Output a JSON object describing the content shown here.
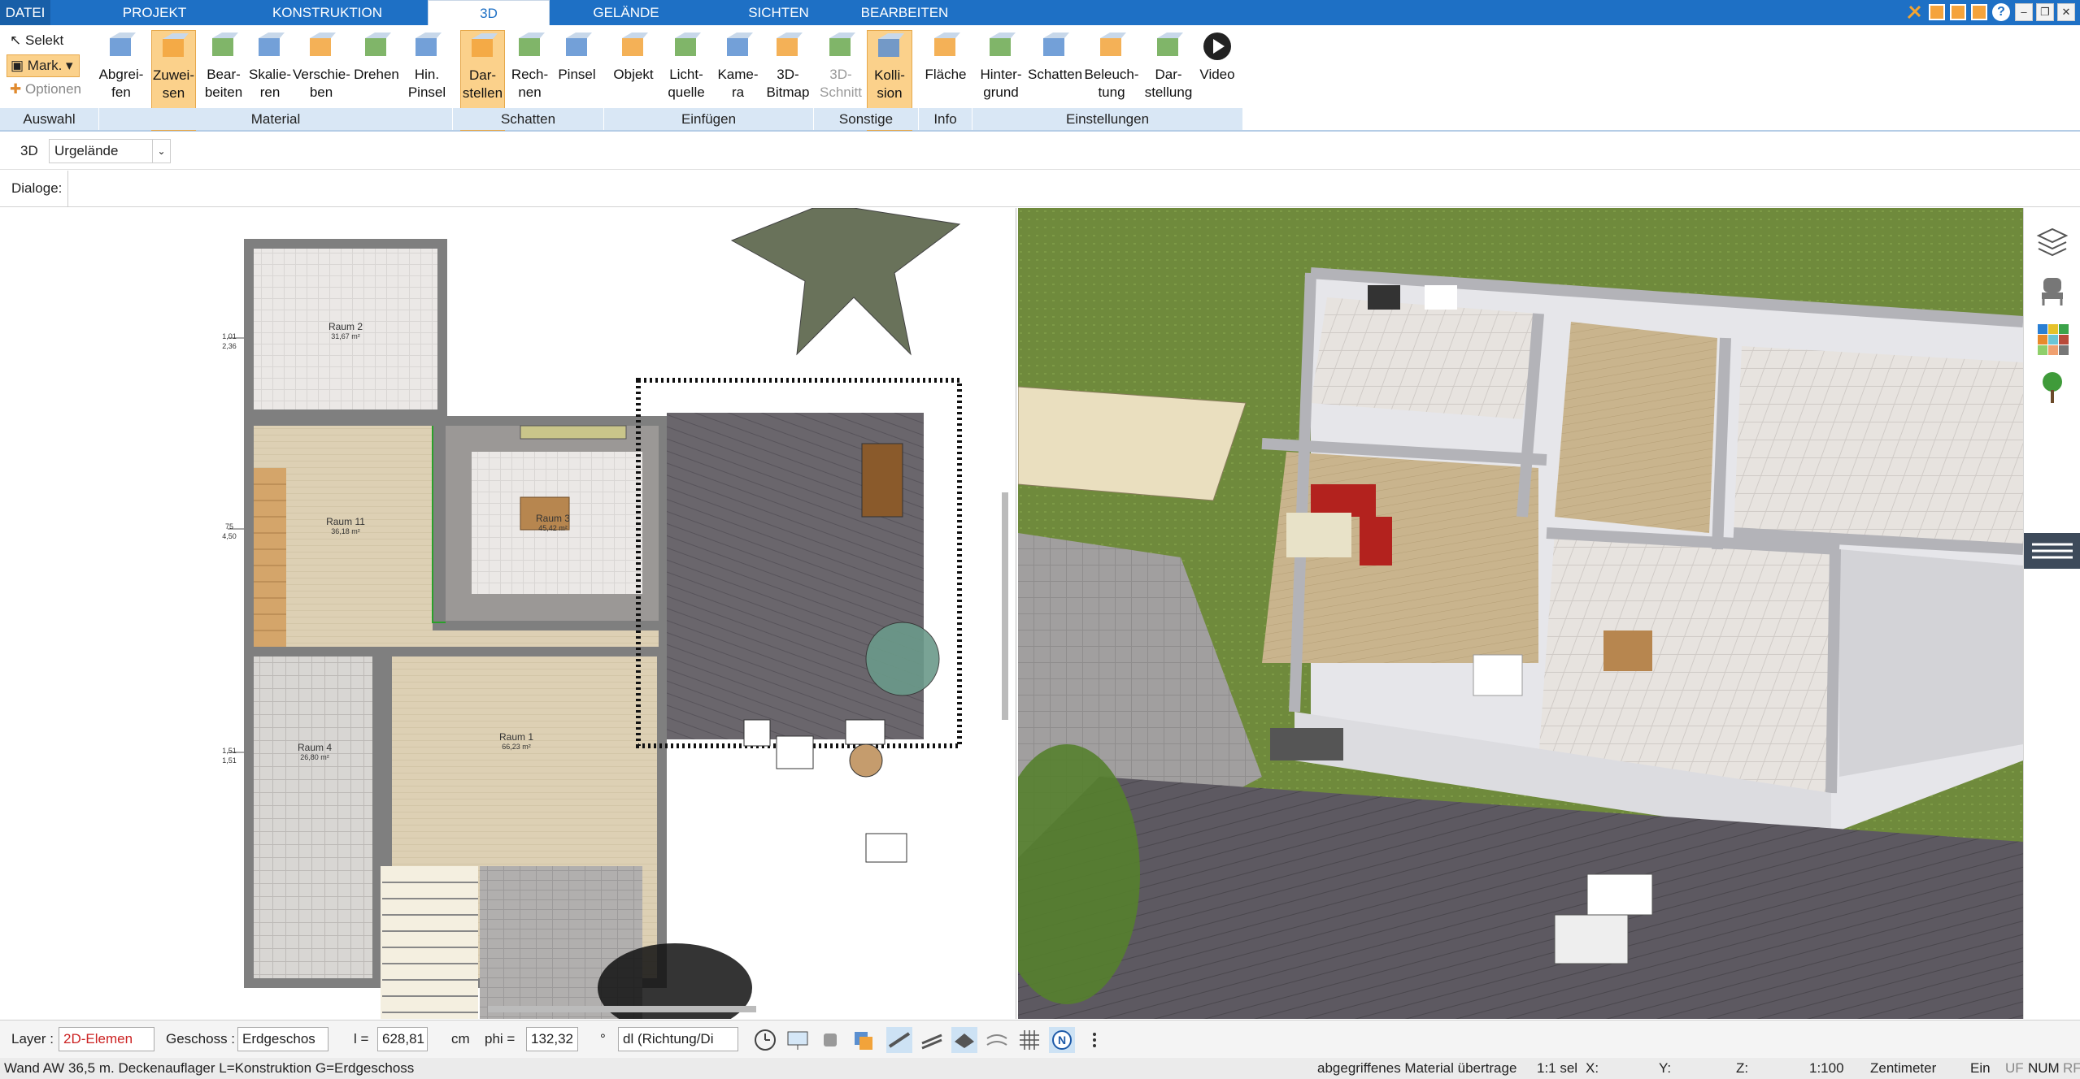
{
  "menu": {
    "tabs": [
      "DATEI",
      "PROJEKT",
      "KONSTRUKTION",
      "3D",
      "GELÄNDE",
      "SICHTEN",
      "BEARBEITEN"
    ],
    "active": "3D"
  },
  "window_controls": [
    "minimize",
    "restore",
    "close"
  ],
  "ribbon": {
    "auswahl": {
      "select": "Selekt",
      "mark": "Mark.",
      "options": "Optionen",
      "group": "Auswahl"
    },
    "material": {
      "group": "Material",
      "buttons": [
        {
          "l1": "Abgrei-",
          "l2": "fen"
        },
        {
          "l1": "Zuwei-",
          "l2": "sen"
        },
        {
          "l1": "Bear-",
          "l2": "beiten"
        },
        {
          "l1": "Skalie-",
          "l2": "ren"
        },
        {
          "l1": "Verschie-",
          "l2": "ben"
        },
        {
          "l1": "Drehen",
          "l2": ""
        },
        {
          "l1": "Hin.",
          "l2": "Pinsel"
        }
      ]
    },
    "schatten": {
      "group": "Schatten",
      "buttons": [
        {
          "l1": "Dar-",
          "l2": "stellen"
        },
        {
          "l1": "Rech-",
          "l2": "nen"
        },
        {
          "l1": "Pinsel",
          "l2": ""
        }
      ]
    },
    "einfuegen": {
      "group": "Einfügen",
      "buttons": [
        {
          "l1": "Objekt",
          "l2": ""
        },
        {
          "l1": "Licht-",
          "l2": "quelle"
        },
        {
          "l1": "Kame-",
          "l2": "ra"
        },
        {
          "l1": "3D-",
          "l2": "Bitmap"
        }
      ]
    },
    "sonstige": {
      "group": "Sonstige",
      "buttons": [
        {
          "l1": "3D-",
          "l2": "Schnitt"
        },
        {
          "l1": "Kolli-",
          "l2": "sion"
        }
      ]
    },
    "info": {
      "group": "Info",
      "buttons": [
        {
          "l1": "Fläche",
          "l2": ""
        }
      ]
    },
    "einstellungen": {
      "group": "Einstellungen",
      "buttons": [
        {
          "l1": "Hinter-",
          "l2": "grund"
        },
        {
          "l1": "Schatten",
          "l2": ""
        },
        {
          "l1": "Beleuch-",
          "l2": "tung"
        },
        {
          "l1": "Dar-",
          "l2": "stellung"
        },
        {
          "l1": "Video",
          "l2": ""
        }
      ]
    }
  },
  "toolbar2": {
    "prefix": "3D",
    "dropdown": "Urgelände"
  },
  "dialogs_label": "Dialoge:",
  "plan": {
    "rooms": [
      {
        "name": "Raum 2",
        "area": "31,67 m²"
      },
      {
        "name": "Raum 11",
        "area": "36,18 m²"
      },
      {
        "name": "Raum 3",
        "area": "45,42 m²"
      },
      {
        "name": "Raum 1",
        "area": "66,23 m²"
      },
      {
        "name": "Raum 4",
        "area": "26,80 m²"
      }
    ],
    "dims": [
      "1,01",
      "2,36",
      "75",
      "4,50",
      "1,51",
      "1,51"
    ]
  },
  "bottom": {
    "layer_label": "Layer :",
    "layer_value": "2D-Elemen",
    "floor_label": "Geschoss :",
    "floor_value": "Erdgeschos",
    "l_label": "l =",
    "l_value": "628,81",
    "l_unit": "cm",
    "phi_label": "phi =",
    "phi_value": "132,32",
    "phi_unit": "°",
    "dl_value": "dl (Richtung/Di"
  },
  "status": {
    "left": "Wand AW 36,5 m. Deckenauflager L=Konstruktion G=Erdgeschoss",
    "material": "abgegriffenes Material übertrage",
    "scale_sel": "1:1 sel",
    "x": "X:",
    "y": "Y:",
    "z": "Z:",
    "scale": "1:100",
    "unit": "Zentimeter",
    "ein": "Ein",
    "uf": "UF",
    "num": "NUM",
    "rf": "RF"
  },
  "colors": {
    "menubar": "#1e70c5",
    "highlight": "#fbd18b",
    "group_bg": "#d9e7f5",
    "grass": "#6f8a3c",
    "floor_wood": "#d9cdb2",
    "terrace": "#5d5961"
  }
}
